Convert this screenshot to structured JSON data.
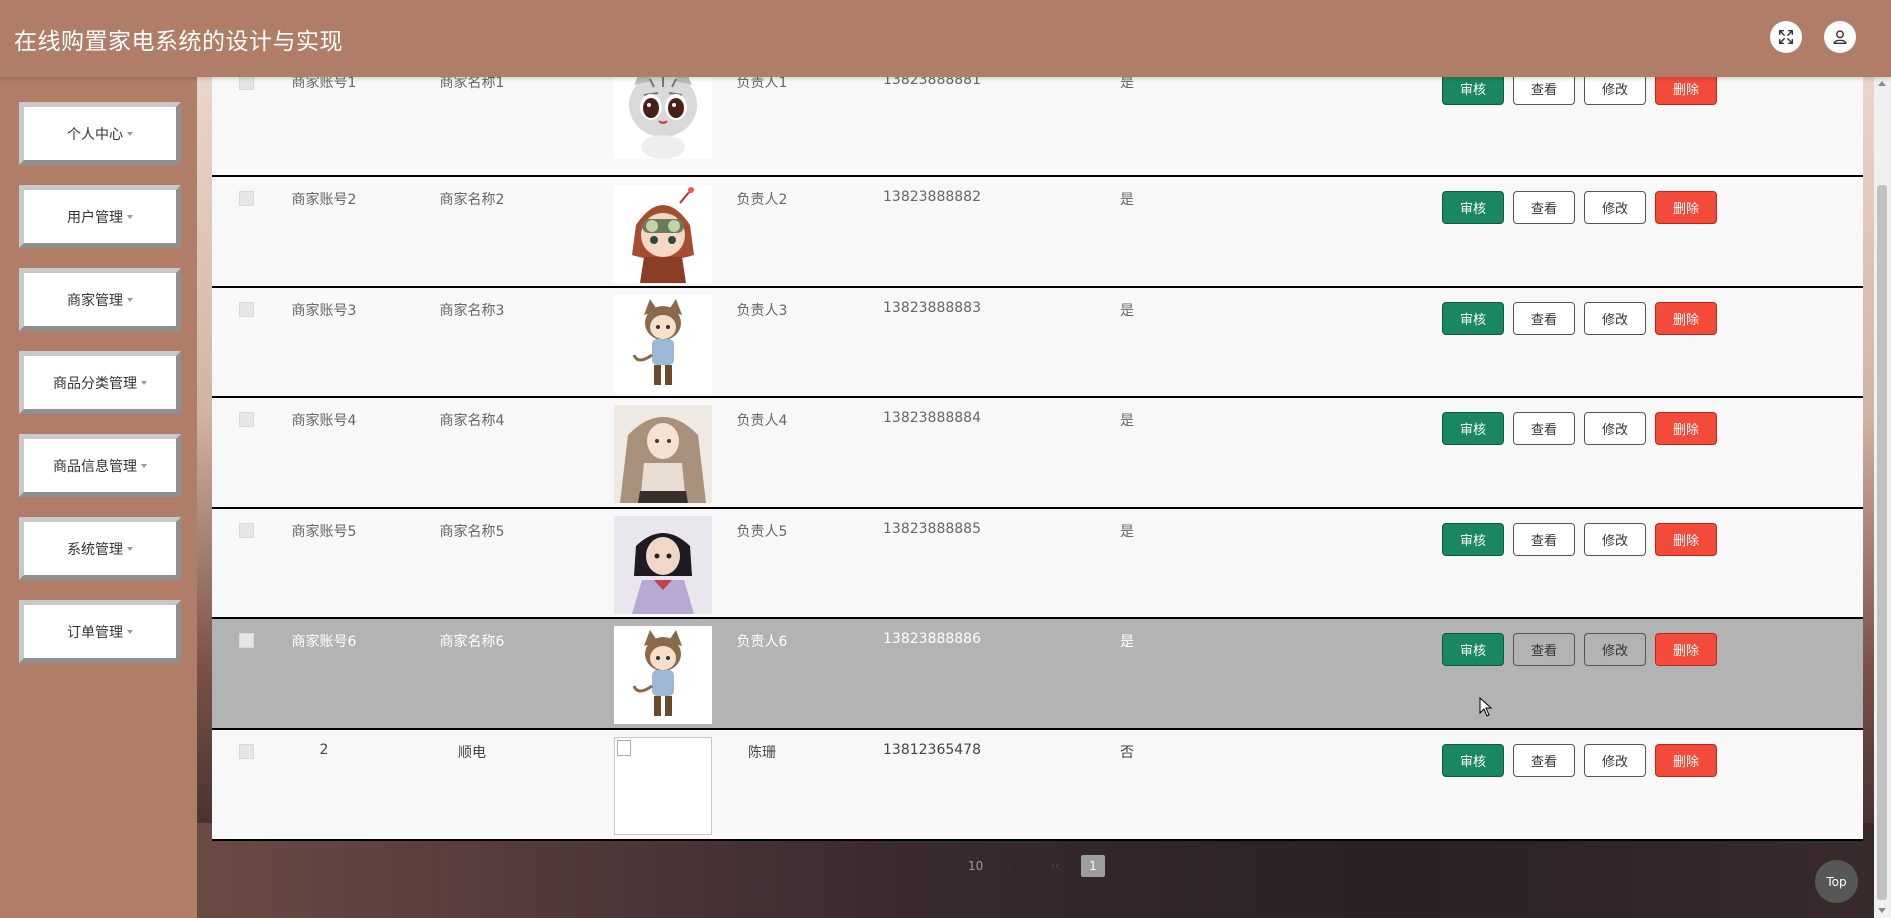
{
  "app": {
    "title": "在线购置家电系统的设计与实现"
  },
  "header": {
    "fullscreen_icon": "fullscreen-icon",
    "user_icon": "user-icon"
  },
  "sidebar": {
    "items": [
      {
        "label": "个人中心"
      },
      {
        "label": "用户管理"
      },
      {
        "label": "商家管理"
      },
      {
        "label": "商品分类管理"
      },
      {
        "label": "商品信息管理"
      },
      {
        "label": "系统管理"
      },
      {
        "label": "订单管理"
      }
    ]
  },
  "table": {
    "rows": [
      {
        "account": "商家账号1",
        "name": "商家名称1",
        "person": "负责人1",
        "phone": "13823888881",
        "status": "是",
        "image": "cat-character"
      },
      {
        "account": "商家账号2",
        "name": "商家名称2",
        "person": "负责人2",
        "phone": "13823888882",
        "status": "是",
        "image": "girl-goggles-character"
      },
      {
        "account": "商家账号3",
        "name": "商家名称3",
        "person": "负责人3",
        "phone": "13823888883",
        "status": "是",
        "image": "catboy-character"
      },
      {
        "account": "商家账号4",
        "name": "商家名称4",
        "person": "负责人4",
        "phone": "13823888884",
        "status": "是",
        "image": "long-hair-girl"
      },
      {
        "account": "商家账号5",
        "name": "商家名称5",
        "person": "负责人5",
        "phone": "13823888885",
        "status": "是",
        "image": "short-hair-girl"
      },
      {
        "account": "商家账号6",
        "name": "商家名称6",
        "person": "负责人6",
        "phone": "13823888886",
        "status": "是",
        "image": "catboy-character"
      },
      {
        "account": "2",
        "name": "顺电",
        "person": "陈珊",
        "phone": "13812365478",
        "status": "否",
        "image": "broken-image"
      }
    ],
    "actions": {
      "audit": "审核",
      "view": "查看",
      "edit": "修改",
      "delete": "删除"
    }
  },
  "pagination": {
    "page_size": "10",
    "prev": "‹‹",
    "current_page": "1"
  },
  "top_button": "Top",
  "colors": {
    "header": "#b07e68",
    "audit": "#19875f",
    "delete": "#f44a3a",
    "hover_row": "#b3b3b3"
  }
}
